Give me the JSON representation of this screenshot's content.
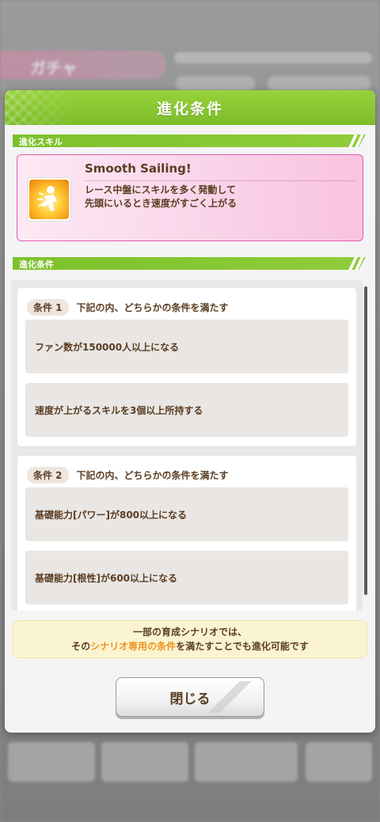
{
  "background": {
    "header_label": "ガチャ"
  },
  "modal": {
    "title": "進化条件",
    "skill_section_label": "進化スキル",
    "skill": {
      "name": "Smooth Sailing!",
      "description_line1": "レース中盤にスキルを多く発動して",
      "description_line2": "先頭にいるとき速度がすごく上がる",
      "icon": "running-figure-sparkle-icon"
    },
    "conditions_section_label": "進化条件",
    "conditions": [
      {
        "tag": "条件 1",
        "title": "下記の内、どちらかの条件を満たす",
        "items": [
          "ファン数が150000人以上になる",
          "速度が上がるスキルを3個以上所持する"
        ]
      },
      {
        "tag": "条件 2",
        "title": "下記の内、どちらかの条件を満たす",
        "items": [
          "基礎能力[パワー]が800以上になる",
          "基礎能力[根性]が600以上になる"
        ]
      }
    ],
    "notice": {
      "line1": "一部の育成シナリオでは、",
      "line2_prefix": "その",
      "line2_highlight": "シナリオ専用の条件",
      "line2_suffix": "を満たすことでも進化可能です"
    },
    "close_label": "閉じる"
  },
  "colors": {
    "header_green": "#7dbd2a",
    "skill_border": "#e45ab0",
    "highlight_orange": "#ee9322",
    "text_brown": "#5a3d22"
  }
}
